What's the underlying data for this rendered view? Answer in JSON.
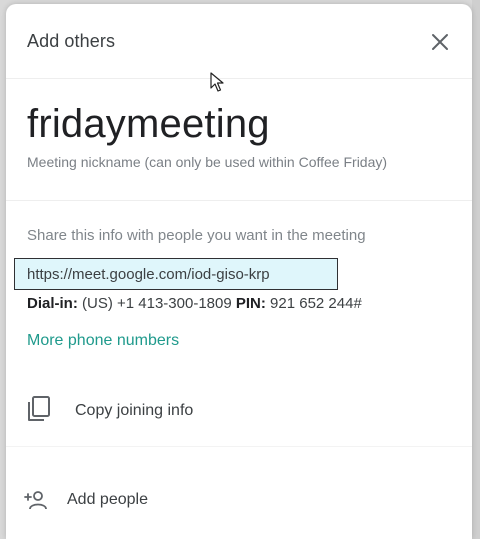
{
  "dialog": {
    "title": "Add others",
    "close_icon": "close-icon"
  },
  "meeting": {
    "nickname": "fridaymeeting",
    "nickname_caption": "Meeting nickname (can only be used within Coffee Friday)"
  },
  "share": {
    "hint": "Share this info with people you want in the meeting",
    "link": "https://meet.google.com/iod-giso-krp",
    "dialin_label": "Dial-in:",
    "dialin_number": "(US) +1 413-300-1809",
    "pin_label": "PIN:",
    "pin_value": "921 652 244#",
    "more_phones": "More phone numbers"
  },
  "actions": {
    "copy_label": "Copy joining info",
    "copy_icon": "copy-icon",
    "add_label": "Add people",
    "add_icon": "add-person-icon"
  },
  "colors": {
    "link_highlight": "#dff6fb",
    "accent": "#1f9a8c",
    "text": "#3c4043"
  }
}
